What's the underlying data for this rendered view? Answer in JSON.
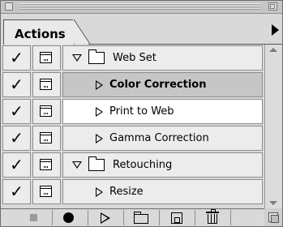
{
  "panel": {
    "tab_label": "Actions"
  },
  "rows": [
    {
      "check": "✓",
      "label": "Web Set",
      "type": "set",
      "expanded": true
    },
    {
      "check": "✓",
      "label": "Color Correction",
      "type": "action",
      "expanded": false,
      "state": "selected"
    },
    {
      "check": "✓",
      "label": "Print to Web",
      "type": "action",
      "expanded": false,
      "state": "highlight"
    },
    {
      "check": "✓",
      "label": "Gamma Correction",
      "type": "action",
      "expanded": false
    },
    {
      "check": "✓",
      "label": "Retouching",
      "type": "set",
      "expanded": true
    },
    {
      "check": "✓",
      "label": "Resize",
      "type": "action",
      "expanded": false
    }
  ],
  "toolbar": {
    "buttons": [
      "stop-icon",
      "record-icon",
      "play-icon",
      "folder-icon",
      "new-action-icon",
      "trash-icon"
    ]
  }
}
